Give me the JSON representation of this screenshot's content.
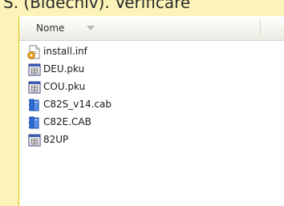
{
  "banner": {
    "text": "S. (Bidechiv). Verificare"
  },
  "header": {
    "name_column": "Nome"
  },
  "files": [
    {
      "name": "install.inf",
      "icon": "setup-info-file-icon"
    },
    {
      "name": "DEU.pku",
      "icon": "generic-file-icon"
    },
    {
      "name": "COU.pku",
      "icon": "generic-file-icon"
    },
    {
      "name": "C82S_v14.cab",
      "icon": "cabinet-archive-icon"
    },
    {
      "name": "C82E.CAB",
      "icon": "cabinet-archive-icon"
    },
    {
      "name": "82UP",
      "icon": "generic-file-icon"
    }
  ],
  "colors": {
    "highlight": "#fbf3b8",
    "border": "#e4c400",
    "cab_blue": "#2f6fd6"
  }
}
